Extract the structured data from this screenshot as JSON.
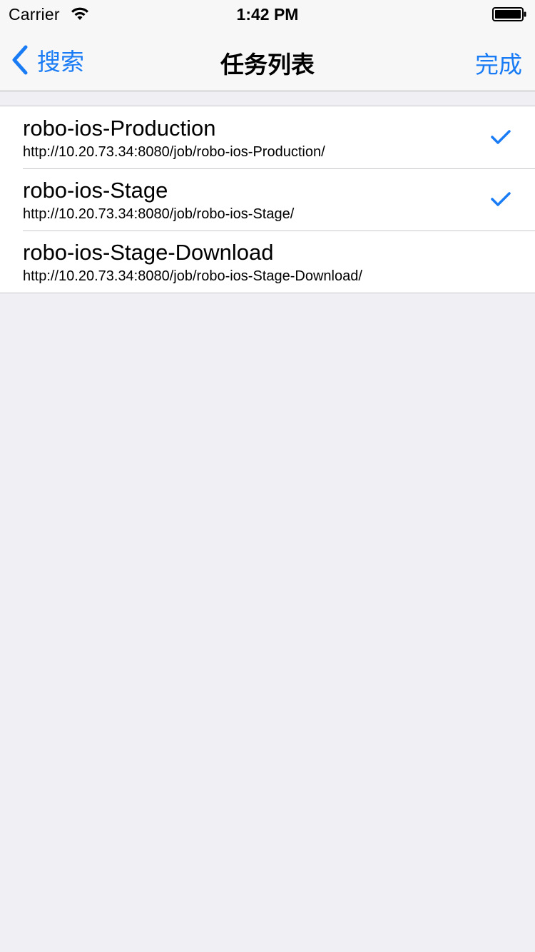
{
  "status_bar": {
    "carrier": "Carrier",
    "time": "1:42 PM"
  },
  "nav": {
    "back_label": "搜索",
    "title": "任务列表",
    "done_label": "完成"
  },
  "colors": {
    "accent": "#1a7cf5",
    "background": "#efeff4",
    "bar_background": "#f7f7f7"
  },
  "icons": {
    "back": "chevron-left-icon",
    "wifi": "wifi-icon",
    "battery": "battery-icon",
    "check": "checkmark-icon"
  },
  "jobs": [
    {
      "name": "robo-ios-Production",
      "url": "http://10.20.73.34:8080/job/robo-ios-Production/",
      "selected": true
    },
    {
      "name": "robo-ios-Stage",
      "url": "http://10.20.73.34:8080/job/robo-ios-Stage/",
      "selected": true
    },
    {
      "name": "robo-ios-Stage-Download",
      "url": "http://10.20.73.34:8080/job/robo-ios-Stage-Download/",
      "selected": false
    }
  ]
}
